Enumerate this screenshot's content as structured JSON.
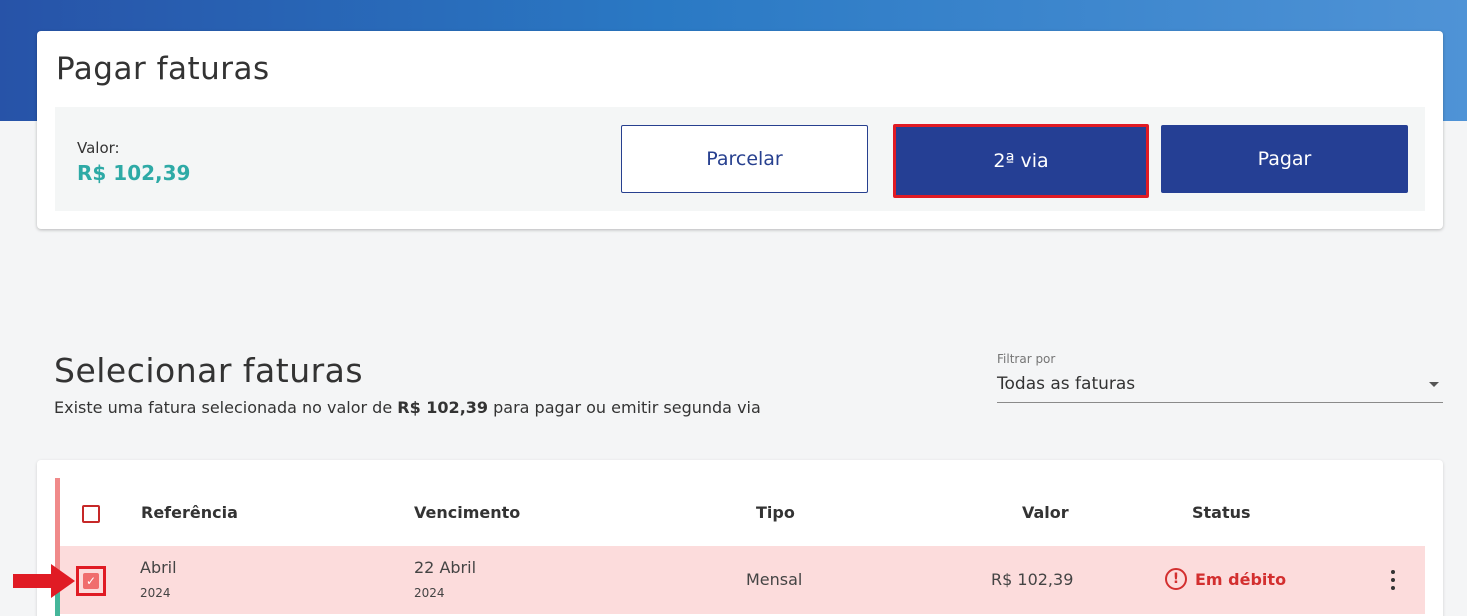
{
  "payment": {
    "title": "Pagar faturas",
    "valor_label": "Valor:",
    "valor_amount": "R$ 102,39",
    "buttons": {
      "parcelar": "Parcelar",
      "segunda_via": "2ª via",
      "pagar": "Pagar"
    }
  },
  "selection": {
    "title": "Selecionar faturas",
    "description_prefix": "Existe uma fatura selecionada no valor de ",
    "description_amount": "R$ 102,39",
    "description_suffix": " para pagar ou emitir segunda via",
    "filter": {
      "label": "Filtrar por",
      "value": "Todas as faturas"
    }
  },
  "table": {
    "headers": {
      "referencia": "Referência",
      "vencimento": "Vencimento",
      "tipo": "Tipo",
      "valor": "Valor",
      "status": "Status"
    },
    "rows": [
      {
        "referencia_month": "Abril",
        "referencia_year": "2024",
        "vencimento_day": "22 Abril",
        "vencimento_year": "2024",
        "tipo": "Mensal",
        "valor": "R$ 102,39",
        "status": "Em débito",
        "status_icon": "!",
        "selected": true
      }
    ]
  },
  "colors": {
    "primary": "#253f94",
    "accent_amount": "#2eaaa6",
    "debt": "#d32f2f",
    "highlight": "#e01b24"
  },
  "icons": {
    "check": "✓",
    "status": "alert-circle-icon",
    "menu": "kebab-menu-icon",
    "caret": "caret-down-icon"
  }
}
